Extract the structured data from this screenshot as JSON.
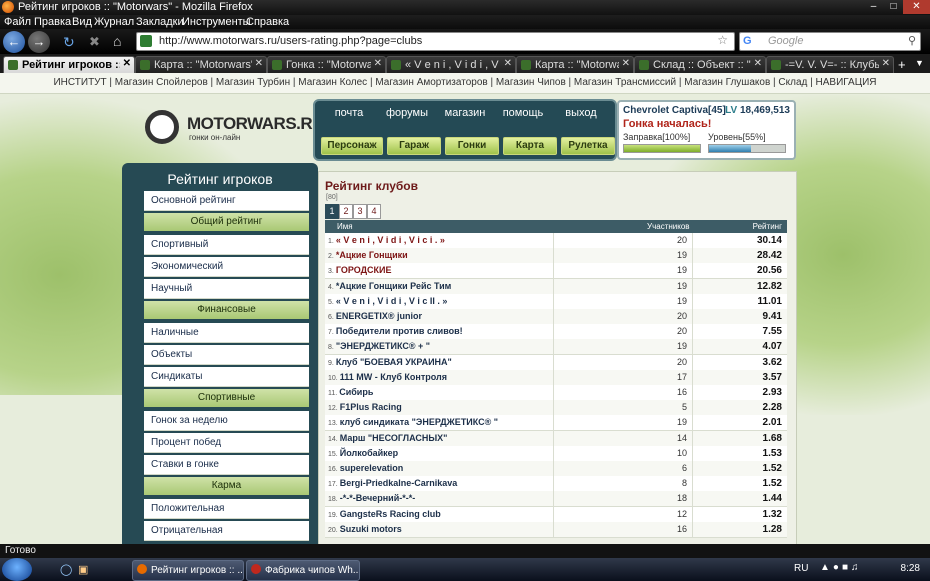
{
  "window": {
    "title": "Рейтинг игроков :: \"Motorwars\" - Mozilla Firefox"
  },
  "menu": [
    "Файл",
    "Правка",
    "Вид",
    "Журнал",
    "Закладки",
    "Инструменты",
    "Справка"
  ],
  "nav": {
    "url": "http://www.motorwars.ru/users-rating.php?page=clubs",
    "search_placeholder": "Google"
  },
  "tabs": [
    {
      "label": "Рейтинг игроков :: ...",
      "active": true
    },
    {
      "label": "Карта :: \"Motorwars\"",
      "active": false
    },
    {
      "label": "Гонка :: \"Motorwars\"",
      "active": false
    },
    {
      "label": "« V e n i , V i d i , V i c ...",
      "active": false
    },
    {
      "label": "Карта :: \"Motorwars\"",
      "active": false
    },
    {
      "label": "Склад :: Объект :: \"M...",
      "active": false
    },
    {
      "label": "-=V. V. V=- :: Клубы :: ...",
      "active": false
    }
  ],
  "site_nav": [
    "ИНСТИТУТ",
    "Магазин Спойлеров",
    "Магазин Турбин",
    "Магазин Колес",
    "Магазин Амортизаторов",
    "Магазин Чипов",
    "Магазин Трансмиссий",
    "Магазин Глушаков",
    "Склад",
    "НАВИГАЦИЯ"
  ],
  "logo": {
    "name": "MOTORWARS.RU",
    "tagline": "гонки он-лайн"
  },
  "main_menu": {
    "top": [
      "почта",
      "форумы",
      "магазин",
      "помощь",
      "выход"
    ],
    "buttons": [
      "Персонаж",
      "Гараж",
      "Гонки",
      "Карта",
      "Рулетка"
    ]
  },
  "car_panel": {
    "car": "Chevrolet Captiva[45]",
    "lv_label": "LV",
    "lv_value": "18,469,513",
    "status": "Гонка началась!",
    "fuel_label": "Заправка[100%]",
    "fuel_pct": 100,
    "level_label": "Уровень[55%]",
    "level_pct": 55
  },
  "sidebar": {
    "header": "Рейтинг игроков",
    "items": [
      {
        "type": "item",
        "label": "Основной рейтинг"
      },
      {
        "type": "head",
        "label": "Общий рейтинг"
      },
      {
        "type": "item",
        "label": "Спортивный"
      },
      {
        "type": "item",
        "label": "Экономический"
      },
      {
        "type": "item",
        "label": "Научный"
      },
      {
        "type": "head",
        "label": "Финансовые"
      },
      {
        "type": "item",
        "label": "Наличные"
      },
      {
        "type": "item",
        "label": "Объекты"
      },
      {
        "type": "item",
        "label": "Синдикаты"
      },
      {
        "type": "head",
        "label": "Спортивные"
      },
      {
        "type": "item",
        "label": "Гонок за неделю"
      },
      {
        "type": "item",
        "label": "Процент побед"
      },
      {
        "type": "item",
        "label": "Ставки в гонке"
      },
      {
        "type": "head",
        "label": "Карма"
      },
      {
        "type": "item",
        "label": "Положительная"
      },
      {
        "type": "item",
        "label": "Отрицательная"
      }
    ]
  },
  "content": {
    "title": "Рейтинг клубов",
    "count": "[80]",
    "pages": [
      "1",
      "2",
      "3",
      "4"
    ],
    "current_page": "1",
    "columns": [
      "Имя",
      "Участников",
      "Рейтинг"
    ],
    "rows": [
      {
        "n": "1.",
        "name": "« V e n i , V i d i , V i c i . »",
        "members": "20",
        "rating": "30.14",
        "red": true
      },
      {
        "n": "2.",
        "name": "*Ацкие Гонщики",
        "members": "19",
        "rating": "28.42",
        "red": true
      },
      {
        "n": "3.",
        "name": "ГОРОДСКИЕ",
        "members": "19",
        "rating": "20.56",
        "red": true
      },
      {
        "n": "4.",
        "name": "*Ацкие Гонщики Рейс Тим",
        "members": "19",
        "rating": "12.82",
        "red": false
      },
      {
        "n": "5.",
        "name": "« V e n i , V i d i , V i c II . »",
        "members": "19",
        "rating": "11.01",
        "red": false
      },
      {
        "n": "6.",
        "name": "ENERGETIX® junior",
        "members": "20",
        "rating": "9.41",
        "red": false
      },
      {
        "n": "7.",
        "name": "Победители против сливов!",
        "members": "20",
        "rating": "7.55",
        "red": false
      },
      {
        "n": "8.",
        "name": "\"ЭНЕРДЖЕТИКС® + \"",
        "members": "19",
        "rating": "4.07",
        "red": false
      },
      {
        "n": "9.",
        "name": "Клуб \"БОЕВАЯ УКРАИНА\"",
        "members": "20",
        "rating": "3.62",
        "red": false
      },
      {
        "n": "10.",
        "name": "111 MW - Клуб Контроля",
        "members": "17",
        "rating": "3.57",
        "red": false
      },
      {
        "n": "11.",
        "name": "Сибирь",
        "members": "16",
        "rating": "2.93",
        "red": false
      },
      {
        "n": "12.",
        "name": "F1Plus Racing",
        "members": "5",
        "rating": "2.28",
        "red": false
      },
      {
        "n": "13.",
        "name": "клуб синдиката \"ЭНЕРДЖЕТИКС® \"",
        "members": "19",
        "rating": "2.01",
        "red": false
      },
      {
        "n": "14.",
        "name": "Марш \"НЕСОГЛАСНЫХ\"",
        "members": "14",
        "rating": "1.68",
        "red": false
      },
      {
        "n": "15.",
        "name": "Йолкобайкер",
        "members": "10",
        "rating": "1.53",
        "red": false
      },
      {
        "n": "16.",
        "name": "superelevation",
        "members": "6",
        "rating": "1.52",
        "red": false
      },
      {
        "n": "17.",
        "name": "Bergi-Priedkalne-Carnikava",
        "members": "8",
        "rating": "1.52",
        "red": false
      },
      {
        "n": "18.",
        "name": "-*-*-Вечерний-*-*-",
        "members": "18",
        "rating": "1.44",
        "red": false
      },
      {
        "n": "19.",
        "name": "GangsteRs Racing club",
        "members": "12",
        "rating": "1.32",
        "red": false
      },
      {
        "n": "20.",
        "name": "Suzuki motors",
        "members": "16",
        "rating": "1.28",
        "red": false
      }
    ]
  },
  "status": "Готово",
  "taskbar": {
    "buttons": [
      "Рейтинг игроков :: ...",
      "Фабрика чипов Wh..."
    ],
    "lang": "RU",
    "time": "8:28"
  },
  "colors": {
    "accent_green": "#a9c874",
    "panel_teal": "#264a54",
    "club_red": "#7d1414"
  }
}
